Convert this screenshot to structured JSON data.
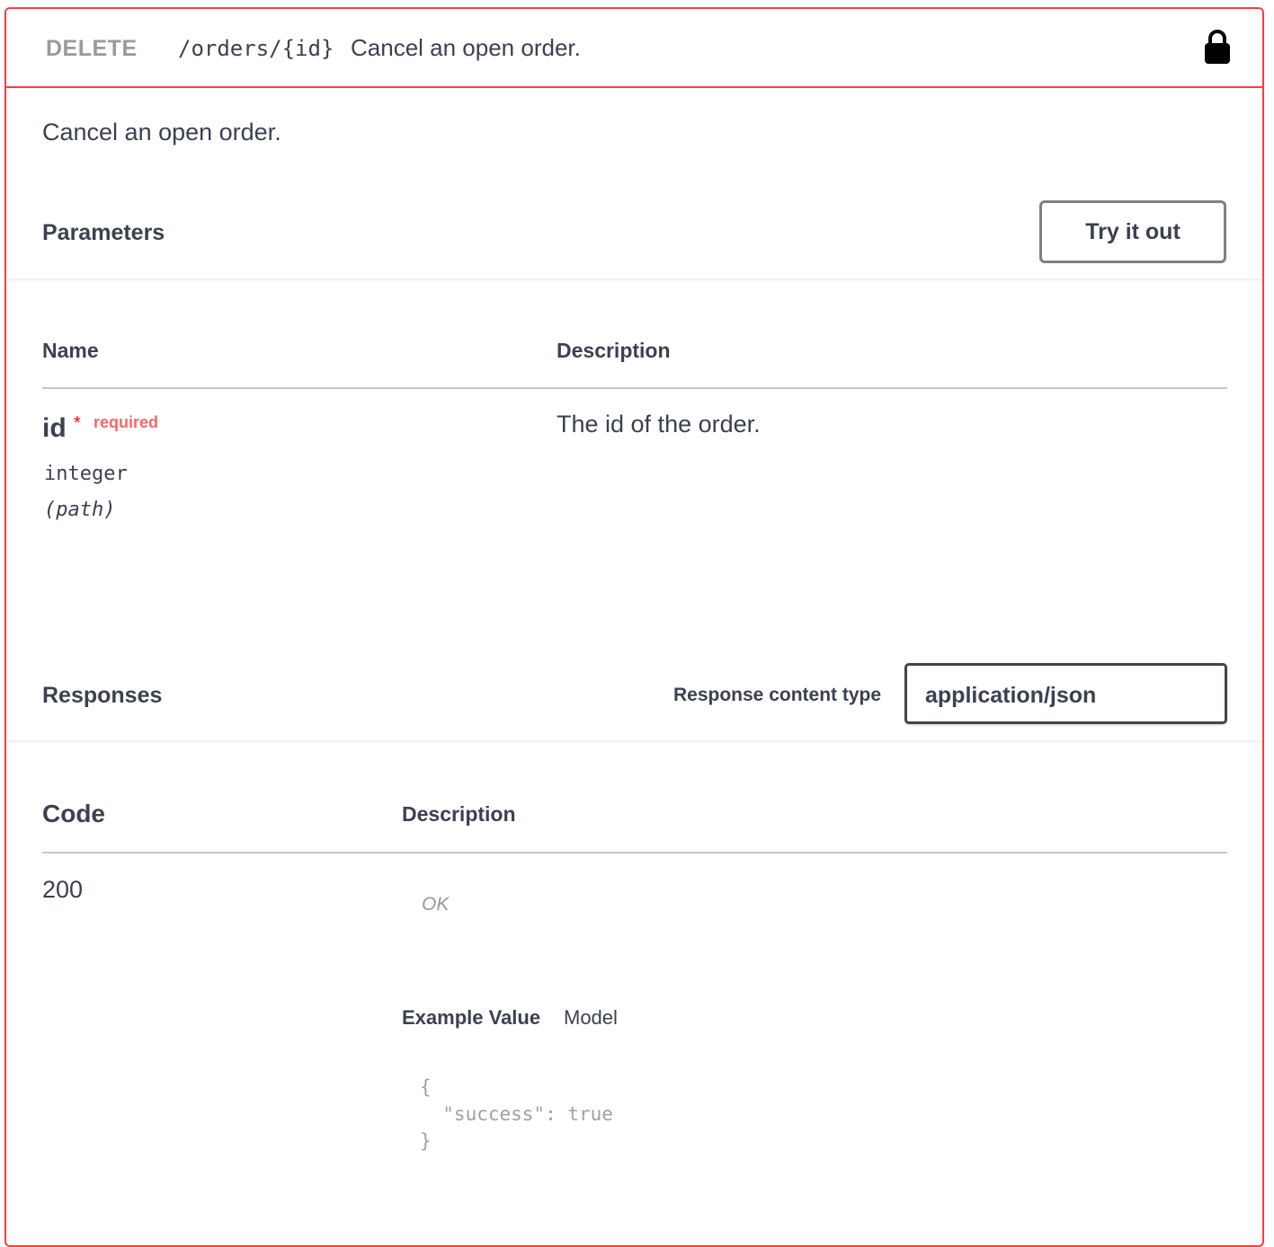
{
  "summary": {
    "method": "DELETE",
    "path": "/orders/{id}",
    "description": "Cancel an open order."
  },
  "description": "Cancel an open order.",
  "parameters": {
    "title": "Parameters",
    "try_label": "Try it out",
    "columns": {
      "name": "Name",
      "description": "Description"
    },
    "items": [
      {
        "name": "id",
        "required_mark": "*",
        "required_label": "required",
        "type": "integer",
        "in": "(path)",
        "description": "The id of the order."
      }
    ]
  },
  "responses": {
    "title": "Responses",
    "content_type_label": "Response content type",
    "content_type_value": "application/json",
    "columns": {
      "code": "Code",
      "description": "Description"
    },
    "items": [
      {
        "code": "200",
        "description": "OK",
        "tabs": {
          "example": "Example Value",
          "model": "Model"
        },
        "example": "{\n  \"success\": true\n}"
      }
    ]
  },
  "colors": {
    "delete_accent": "#f93e3e",
    "required": "#f86767",
    "text": "#3b4151"
  }
}
